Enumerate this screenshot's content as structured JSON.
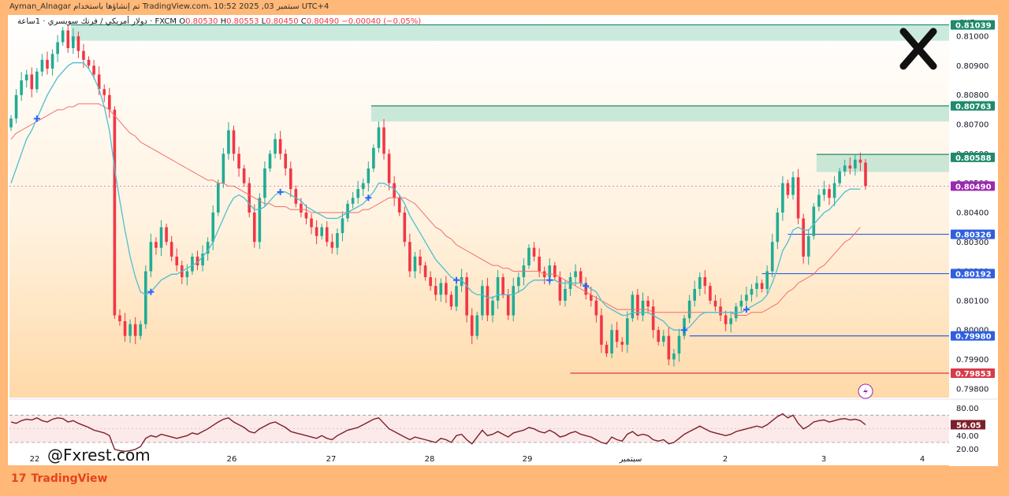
{
  "topbar": {
    "text": "Ayman_Alnagar تم إنشاؤها باستخدام TradingView.com، 10:52 2025 ,03 سبتمبر UTC+4"
  },
  "legend": {
    "symbol": "دولار أمريكي / فرنك سويسري · 1ساعة · FXCM",
    "o_label": "O",
    "o": "0.80530",
    "h_label": "H",
    "h": "0.80553",
    "l_label": "L",
    "l": "0.80450",
    "c_label": "C",
    "c": "0.80490",
    "change": "−0.00040 (−0.05%)"
  },
  "currency": "CHF",
  "watermark": "@Fxrest.com",
  "tv_brand": "TradingView",
  "colors": {
    "up": "#22ab94",
    "down": "#f23645",
    "ema_fast": "#4cbfd1",
    "ema_slow": "#f26d6d",
    "zone": "#a6dcc8",
    "zone_line": "#1f8a6b",
    "support": "#2f5fe0",
    "low_line": "#d83a4a",
    "rsi": "#7d1f2a",
    "price": "#9c27b0"
  },
  "chart_data": {
    "type": "candlestick",
    "ylim": [
      0.7977,
      0.8107
    ],
    "x_ticks": [
      "22",
      "",
      "26",
      "27",
      "28",
      "29",
      "سبتمبر",
      "2",
      "3",
      "4"
    ],
    "y_ticks": [
      "0.81000",
      "0.80900",
      "0.80800",
      "0.80700",
      "0.80600",
      "0.80500",
      "0.80400",
      "0.80300",
      "0.80200",
      "0.80100",
      "0.80000",
      "0.79900",
      "0.79800"
    ],
    "price_tags": [
      {
        "value": 0.81039,
        "label": "0.81039",
        "kind": "zone"
      },
      {
        "value": 0.80763,
        "label": "0.80763",
        "kind": "zone"
      },
      {
        "value": 0.80588,
        "label": "0.80588",
        "kind": "zone"
      },
      {
        "value": 0.8049,
        "label": "0.80490",
        "kind": "price"
      },
      {
        "value": 0.80326,
        "label": "0.80326",
        "kind": "support"
      },
      {
        "value": 0.80192,
        "label": "0.80192",
        "kind": "support"
      },
      {
        "value": 0.7998,
        "label": "0.79980",
        "kind": "support"
      },
      {
        "value": 0.79853,
        "label": "0.79853",
        "kind": "low"
      }
    ],
    "zones": [
      {
        "from_index": 12,
        "to_index": 171,
        "low": 0.80985,
        "high": 0.81039
      },
      {
        "from_index": 70,
        "to_index": 171,
        "low": 0.8071,
        "high": 0.80763
      },
      {
        "from_index": 156,
        "to_index": 171,
        "low": 0.80538,
        "high": 0.80598
      }
    ],
    "closes": [
      0.8072,
      0.808,
      0.8085,
      0.8087,
      0.8082,
      0.8088,
      0.8092,
      0.8089,
      0.8094,
      0.8098,
      0.8102,
      0.8096,
      0.81,
      0.8095,
      0.8092,
      0.809,
      0.8087,
      0.8082,
      0.808,
      0.8075,
      0.8005,
      0.8003,
      0.7998,
      0.8002,
      0.7998,
      0.8002,
      0.802,
      0.803,
      0.8028,
      0.8035,
      0.803,
      0.8025,
      0.8022,
      0.8018,
      0.802,
      0.8025,
      0.8022,
      0.8026,
      0.803,
      0.804,
      0.805,
      0.806,
      0.8068,
      0.806,
      0.8055,
      0.805,
      0.804,
      0.803,
      0.8045,
      0.8055,
      0.806,
      0.8065,
      0.806,
      0.8055,
      0.8048,
      0.8043,
      0.804,
      0.8038,
      0.8035,
      0.8032,
      0.8035,
      0.803,
      0.8028,
      0.8033,
      0.8038,
      0.8043,
      0.8045,
      0.8048,
      0.805,
      0.8055,
      0.8062,
      0.8069,
      0.806,
      0.805,
      0.8045,
      0.804,
      0.803,
      0.802,
      0.8025,
      0.8022,
      0.8018,
      0.8015,
      0.8012,
      0.8016,
      0.8012,
      0.8008,
      0.8015,
      0.8018,
      0.8005,
      0.7998,
      0.8005,
      0.8015,
      0.8005,
      0.801,
      0.8018,
      0.8012,
      0.8005,
      0.8015,
      0.8018,
      0.8022,
      0.8028,
      0.8025,
      0.802,
      0.8018,
      0.8022,
      0.8018,
      0.801,
      0.8014,
      0.8018,
      0.802,
      0.8016,
      0.8012,
      0.801,
      0.8005,
      0.7995,
      0.7992,
      0.8,
      0.7996,
      0.7995,
      0.8004,
      0.8012,
      0.8005,
      0.801,
      0.8008,
      0.8,
      0.7996,
      0.7998,
      0.799,
      0.7992,
      0.7998,
      0.8004,
      0.801,
      0.8014,
      0.8018,
      0.8015,
      0.801,
      0.8008,
      0.8005,
      0.8002,
      0.8004,
      0.8008,
      0.801,
      0.8012,
      0.8014,
      0.8016,
      0.8014,
      0.802,
      0.803,
      0.804,
      0.805,
      0.8046,
      0.8052,
      0.8038,
      0.8025,
      0.8032,
      0.8042,
      0.8046,
      0.8048,
      0.8045,
      0.805,
      0.8054,
      0.8056,
      0.8055,
      0.8058,
      0.8057,
      0.8049
    ],
    "ema_fast": [
      0.805,
      0.8055,
      0.806,
      0.8065,
      0.8068,
      0.8072,
      0.8076,
      0.808,
      0.8083,
      0.8086,
      0.8088,
      0.809,
      0.8091,
      0.8091,
      0.8091,
      0.8089,
      0.8086,
      0.8082,
      0.8076,
      0.8068,
      0.8055,
      0.8044,
      0.8034,
      0.8025,
      0.8018,
      0.8013,
      0.8012,
      0.8013,
      0.8015,
      0.8017,
      0.8018,
      0.8019,
      0.8019,
      0.802,
      0.8021,
      0.8022,
      0.8023,
      0.8025,
      0.8027,
      0.803,
      0.8034,
      0.8038,
      0.8042,
      0.8045,
      0.8046,
      0.8045,
      0.8043,
      0.8041,
      0.8041,
      0.8042,
      0.8044,
      0.8046,
      0.8047,
      0.8047,
      0.8046,
      0.8045,
      0.8044,
      0.8042,
      0.8041,
      0.804,
      0.8039,
      0.8038,
      0.8038,
      0.8038,
      0.8039,
      0.804,
      0.8041,
      0.8042,
      0.8043,
      0.8045,
      0.8047,
      0.805,
      0.805,
      0.8049,
      0.8048,
      0.8046,
      0.8043,
      0.8039,
      0.8036,
      0.8033,
      0.803,
      0.8027,
      0.8024,
      0.8022,
      0.802,
      0.8018,
      0.8017,
      0.8017,
      0.8015,
      0.8013,
      0.8012,
      0.8012,
      0.8011,
      0.8011,
      0.8012,
      0.8012,
      0.8012,
      0.8012,
      0.8013,
      0.8014,
      0.8016,
      0.8017,
      0.8017,
      0.8017,
      0.8017,
      0.8017,
      0.8016,
      0.8016,
      0.8016,
      0.8016,
      0.8016,
      0.8015,
      0.8014,
      0.8013,
      0.801,
      0.8008,
      0.8007,
      0.8006,
      0.8005,
      0.8005,
      0.8006,
      0.8006,
      0.8006,
      0.8006,
      0.8005,
      0.8004,
      0.8003,
      0.8001,
      0.8,
      0.8,
      0.8,
      0.8001,
      0.8003,
      0.8005,
      0.8006,
      0.8006,
      0.8006,
      0.8006,
      0.8006,
      0.8006,
      0.8006,
      0.8006,
      0.8007,
      0.8008,
      0.8009,
      0.801,
      0.8012,
      0.8016,
      0.8021,
      0.8027,
      0.803,
      0.8034,
      0.8035,
      0.8034,
      0.8034,
      0.8036,
      0.8038,
      0.804,
      0.8041,
      0.8043,
      0.8045,
      0.8047,
      0.8048,
      0.8048,
      0.8048
    ],
    "ema_slow": [
      0.8065,
      0.8067,
      0.8068,
      0.8069,
      0.807,
      0.8071,
      0.8072,
      0.8073,
      0.8074,
      0.8075,
      0.8075,
      0.8076,
      0.8076,
      0.8077,
      0.8077,
      0.8077,
      0.8077,
      0.8077,
      0.8076,
      0.8075,
      0.8073,
      0.8071,
      0.8069,
      0.8067,
      0.8066,
      0.8064,
      0.8063,
      0.8062,
      0.8061,
      0.806,
      0.8059,
      0.8058,
      0.8057,
      0.8056,
      0.8055,
      0.8054,
      0.8053,
      0.8052,
      0.8051,
      0.8051,
      0.805,
      0.805,
      0.8049,
      0.8049,
      0.8048,
      0.8047,
      0.8046,
      0.8045,
      0.8044,
      0.8043,
      0.8043,
      0.8042,
      0.8042,
      0.8042,
      0.8041,
      0.8041,
      0.8041,
      0.8041,
      0.804,
      0.804,
      0.804,
      0.804,
      0.804,
      0.804,
      0.804,
      0.804,
      0.804,
      0.804,
      0.8041,
      0.8041,
      0.8042,
      0.8043,
      0.8044,
      0.8045,
      0.8045,
      0.8045,
      0.8045,
      0.8044,
      0.8043,
      0.8041,
      0.8039,
      0.8037,
      0.8035,
      0.8034,
      0.8032,
      0.8031,
      0.8029,
      0.8028,
      0.8027,
      0.8026,
      0.8025,
      0.8024,
      0.8023,
      0.8022,
      0.8022,
      0.8021,
      0.8021,
      0.802,
      0.802,
      0.802,
      0.802,
      0.802,
      0.802,
      0.8019,
      0.8019,
      0.8019,
      0.8018,
      0.8017,
      0.8016,
      0.8015,
      0.8014,
      0.8013,
      0.8012,
      0.8011,
      0.801,
      0.8009,
      0.8008,
      0.8007,
      0.8007,
      0.8007,
      0.8007,
      0.8007,
      0.8007,
      0.8007,
      0.8006,
      0.8006,
      0.8006,
      0.8006,
      0.8006,
      0.8006,
      0.8006,
      0.8006,
      0.8006,
      0.8006,
      0.8006,
      0.8006,
      0.8006,
      0.8006,
      0.8006,
      0.8006,
      0.8005,
      0.8005,
      0.8005,
      0.8006,
      0.8006,
      0.8006,
      0.8007,
      0.8008,
      0.8009,
      0.8011,
      0.8013,
      0.8014,
      0.8016,
      0.8017,
      0.8018,
      0.8019,
      0.8021,
      0.8022,
      0.8024,
      0.8026,
      0.8028,
      0.803,
      0.8031,
      0.8033,
      0.8035
    ],
    "rsi": {
      "value": "56.05",
      "ylim": [
        15,
        90
      ],
      "y_ticks": [
        "80.00",
        "40.00",
        "20.00"
      ],
      "levels": [
        70,
        30
      ],
      "values": [
        60,
        58,
        62,
        64,
        63,
        66,
        62,
        60,
        64,
        66,
        65,
        60,
        62,
        58,
        55,
        52,
        48,
        46,
        44,
        40,
        20,
        18,
        17,
        18,
        20,
        24,
        36,
        40,
        38,
        42,
        40,
        38,
        36,
        38,
        40,
        44,
        42,
        46,
        50,
        55,
        60,
        64,
        66,
        60,
        56,
        52,
        46,
        44,
        50,
        54,
        58,
        60,
        56,
        52,
        46,
        44,
        42,
        40,
        38,
        36,
        40,
        36,
        34,
        40,
        44,
        48,
        50,
        52,
        56,
        60,
        64,
        66,
        58,
        50,
        46,
        42,
        38,
        34,
        38,
        36,
        34,
        32,
        30,
        36,
        34,
        30,
        40,
        42,
        34,
        28,
        38,
        48,
        40,
        42,
        46,
        42,
        38,
        44,
        46,
        48,
        52,
        50,
        46,
        44,
        48,
        44,
        38,
        40,
        44,
        46,
        42,
        40,
        38,
        34,
        30,
        28,
        38,
        34,
        32,
        42,
        46,
        40,
        42,
        40,
        34,
        32,
        34,
        28,
        30,
        36,
        42,
        46,
        50,
        54,
        50,
        46,
        44,
        42,
        40,
        42,
        46,
        48,
        50,
        52,
        54,
        52,
        56,
        62,
        68,
        72,
        66,
        70,
        58,
        50,
        54,
        60,
        62,
        63,
        60,
        62,
        64,
        65,
        63,
        64,
        62,
        56
      ]
    }
  }
}
